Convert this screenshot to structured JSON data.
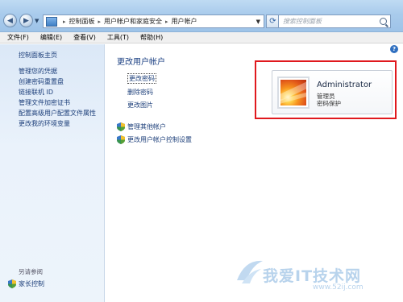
{
  "window": {
    "breadcrumb": [
      "控制面板",
      "用户帐户和家庭安全",
      "用户帐户"
    ],
    "search_placeholder": "搜索控制面板"
  },
  "menu": [
    "文件(F)",
    "编辑(E)",
    "查看(V)",
    "工具(T)",
    "帮助(H)"
  ],
  "sidebar": {
    "home": "控制面板主页",
    "items": [
      "管理您的凭据",
      "创建密码重置盘",
      "链接联机 ID",
      "管理文件加密证书",
      "配置高级用户配置文件属性",
      "更改我的环境变量"
    ],
    "see_also": "另请参阅",
    "family_safety": "家长控制"
  },
  "main": {
    "title": "更改用户帐户",
    "tasks": [
      "更改密码",
      "删除密码",
      "更改图片"
    ],
    "admin_tasks": [
      "管理其他帐户",
      "更改用户帐户控制设置"
    ]
  },
  "account": {
    "name": "Administrator",
    "role": "管理员",
    "password_status": "密码保护"
  },
  "watermark": {
    "text": "我爱IT技术网",
    "url": "www.52ij.com"
  },
  "colors": {
    "link": "#1d3f7a",
    "heading": "#1a3f82",
    "highlight": "#e0191e",
    "sidebar_bg": "#dbe8f7"
  }
}
